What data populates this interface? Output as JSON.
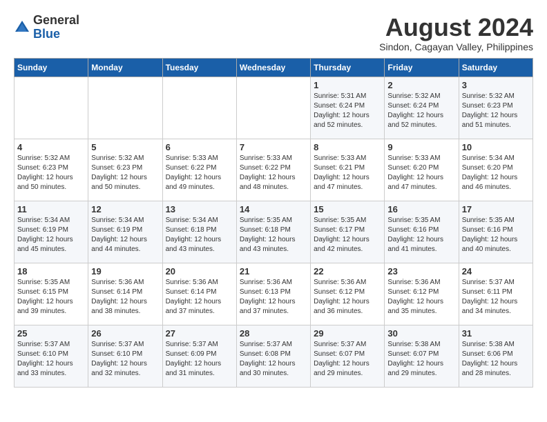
{
  "header": {
    "logo_general": "General",
    "logo_blue": "Blue",
    "month_year": "August 2024",
    "location": "Sindon, Cagayan Valley, Philippines"
  },
  "weekdays": [
    "Sunday",
    "Monday",
    "Tuesday",
    "Wednesday",
    "Thursday",
    "Friday",
    "Saturday"
  ],
  "weeks": [
    [
      {
        "day": "",
        "info": ""
      },
      {
        "day": "",
        "info": ""
      },
      {
        "day": "",
        "info": ""
      },
      {
        "day": "",
        "info": ""
      },
      {
        "day": "1",
        "info": "Sunrise: 5:31 AM\nSunset: 6:24 PM\nDaylight: 12 hours\nand 52 minutes."
      },
      {
        "day": "2",
        "info": "Sunrise: 5:32 AM\nSunset: 6:24 PM\nDaylight: 12 hours\nand 52 minutes."
      },
      {
        "day": "3",
        "info": "Sunrise: 5:32 AM\nSunset: 6:23 PM\nDaylight: 12 hours\nand 51 minutes."
      }
    ],
    [
      {
        "day": "4",
        "info": "Sunrise: 5:32 AM\nSunset: 6:23 PM\nDaylight: 12 hours\nand 50 minutes."
      },
      {
        "day": "5",
        "info": "Sunrise: 5:32 AM\nSunset: 6:23 PM\nDaylight: 12 hours\nand 50 minutes."
      },
      {
        "day": "6",
        "info": "Sunrise: 5:33 AM\nSunset: 6:22 PM\nDaylight: 12 hours\nand 49 minutes."
      },
      {
        "day": "7",
        "info": "Sunrise: 5:33 AM\nSunset: 6:22 PM\nDaylight: 12 hours\nand 48 minutes."
      },
      {
        "day": "8",
        "info": "Sunrise: 5:33 AM\nSunset: 6:21 PM\nDaylight: 12 hours\nand 47 minutes."
      },
      {
        "day": "9",
        "info": "Sunrise: 5:33 AM\nSunset: 6:20 PM\nDaylight: 12 hours\nand 47 minutes."
      },
      {
        "day": "10",
        "info": "Sunrise: 5:34 AM\nSunset: 6:20 PM\nDaylight: 12 hours\nand 46 minutes."
      }
    ],
    [
      {
        "day": "11",
        "info": "Sunrise: 5:34 AM\nSunset: 6:19 PM\nDaylight: 12 hours\nand 45 minutes."
      },
      {
        "day": "12",
        "info": "Sunrise: 5:34 AM\nSunset: 6:19 PM\nDaylight: 12 hours\nand 44 minutes."
      },
      {
        "day": "13",
        "info": "Sunrise: 5:34 AM\nSunset: 6:18 PM\nDaylight: 12 hours\nand 43 minutes."
      },
      {
        "day": "14",
        "info": "Sunrise: 5:35 AM\nSunset: 6:18 PM\nDaylight: 12 hours\nand 43 minutes."
      },
      {
        "day": "15",
        "info": "Sunrise: 5:35 AM\nSunset: 6:17 PM\nDaylight: 12 hours\nand 42 minutes."
      },
      {
        "day": "16",
        "info": "Sunrise: 5:35 AM\nSunset: 6:16 PM\nDaylight: 12 hours\nand 41 minutes."
      },
      {
        "day": "17",
        "info": "Sunrise: 5:35 AM\nSunset: 6:16 PM\nDaylight: 12 hours\nand 40 minutes."
      }
    ],
    [
      {
        "day": "18",
        "info": "Sunrise: 5:35 AM\nSunset: 6:15 PM\nDaylight: 12 hours\nand 39 minutes."
      },
      {
        "day": "19",
        "info": "Sunrise: 5:36 AM\nSunset: 6:14 PM\nDaylight: 12 hours\nand 38 minutes."
      },
      {
        "day": "20",
        "info": "Sunrise: 5:36 AM\nSunset: 6:14 PM\nDaylight: 12 hours\nand 37 minutes."
      },
      {
        "day": "21",
        "info": "Sunrise: 5:36 AM\nSunset: 6:13 PM\nDaylight: 12 hours\nand 37 minutes."
      },
      {
        "day": "22",
        "info": "Sunrise: 5:36 AM\nSunset: 6:12 PM\nDaylight: 12 hours\nand 36 minutes."
      },
      {
        "day": "23",
        "info": "Sunrise: 5:36 AM\nSunset: 6:12 PM\nDaylight: 12 hours\nand 35 minutes."
      },
      {
        "day": "24",
        "info": "Sunrise: 5:37 AM\nSunset: 6:11 PM\nDaylight: 12 hours\nand 34 minutes."
      }
    ],
    [
      {
        "day": "25",
        "info": "Sunrise: 5:37 AM\nSunset: 6:10 PM\nDaylight: 12 hours\nand 33 minutes."
      },
      {
        "day": "26",
        "info": "Sunrise: 5:37 AM\nSunset: 6:10 PM\nDaylight: 12 hours\nand 32 minutes."
      },
      {
        "day": "27",
        "info": "Sunrise: 5:37 AM\nSunset: 6:09 PM\nDaylight: 12 hours\nand 31 minutes."
      },
      {
        "day": "28",
        "info": "Sunrise: 5:37 AM\nSunset: 6:08 PM\nDaylight: 12 hours\nand 30 minutes."
      },
      {
        "day": "29",
        "info": "Sunrise: 5:37 AM\nSunset: 6:07 PM\nDaylight: 12 hours\nand 29 minutes."
      },
      {
        "day": "30",
        "info": "Sunrise: 5:38 AM\nSunset: 6:07 PM\nDaylight: 12 hours\nand 29 minutes."
      },
      {
        "day": "31",
        "info": "Sunrise: 5:38 AM\nSunset: 6:06 PM\nDaylight: 12 hours\nand 28 minutes."
      }
    ]
  ]
}
